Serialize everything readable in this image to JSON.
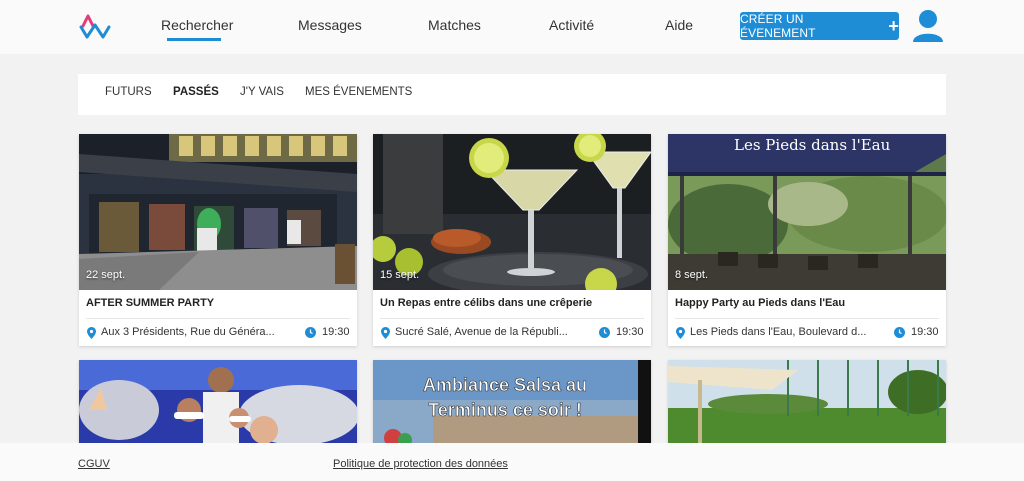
{
  "brand": {
    "accent": "#1f8dd6",
    "logo_colors": [
      "#e23d7a",
      "#1f8dd6"
    ]
  },
  "nav": {
    "search": "Rechercher",
    "messages": "Messages",
    "matches": "Matches",
    "activity": "Activité",
    "help": "Aide",
    "create_event": "CRÉER UN ÉVENEMENT"
  },
  "tabs": {
    "future": "FUTURS",
    "past": "PASSÉS",
    "going": "J'Y VAIS",
    "mine": "MES ÉVENEMENTS",
    "active": "PASSÉS"
  },
  "events": [
    {
      "date": "22 sept.",
      "title": "AFTER SUMMER PARTY",
      "location": "Aux 3 Présidents, Rue du Généra...",
      "time": "19:30"
    },
    {
      "date": "15 sept.",
      "title": "Un Repas entre célibs dans une crêperie",
      "location": "Sucré Salé, Avenue de la Républi...",
      "time": "19:30"
    },
    {
      "date": "8 sept.",
      "title": "Happy Party au Pieds dans l'Eau",
      "location": "Les Pieds dans l'Eau, Boulevard d...",
      "time": "19:30"
    }
  ],
  "images": {
    "sign_text": "Les Pieds dans l'Eau",
    "salsa_line1": "Ambiance Salsa au",
    "salsa_line2": "Terminus ce soir !"
  },
  "footer": {
    "terms": "CGUV",
    "privacy": "Politique de protection des données"
  }
}
